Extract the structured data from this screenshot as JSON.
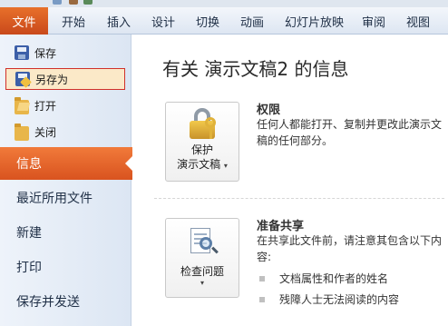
{
  "ribbon": {
    "file_tab": "文件",
    "tabs": [
      "开始",
      "插入",
      "设计",
      "切换",
      "动画",
      "幻灯片放映",
      "审阅",
      "视图"
    ]
  },
  "backstage": {
    "commands": [
      {
        "label": "保存",
        "icon": "save-icon"
      },
      {
        "label": "另存为",
        "icon": "save-as-icon",
        "selected": true
      },
      {
        "label": "打开",
        "icon": "open-folder-icon"
      },
      {
        "label": "关闭",
        "icon": "close-folder-icon"
      }
    ],
    "nav": [
      "信息",
      "最近所用文件",
      "新建",
      "打印",
      "保存并发送"
    ],
    "active_nav": "信息"
  },
  "info": {
    "title": "有关 演示文稿2 的信息",
    "permissions": {
      "button_label_1": "保护",
      "button_label_2": "演示文稿",
      "heading": "权限",
      "description": "任何人都能打开、复制并更改此演示文稿的任何部分。"
    },
    "sharing": {
      "button_label": "检查问题",
      "heading": "准备共享",
      "description": "在共享此文件前，请注意其包含以下内容:",
      "bullets": [
        "文档属性和作者的姓名",
        "残障人士无法阅读的内容"
      ]
    }
  },
  "colors": {
    "file_tab": "#d9531f",
    "selection_border": "#d0302a",
    "ribbon_bg": "#dde6f2"
  }
}
